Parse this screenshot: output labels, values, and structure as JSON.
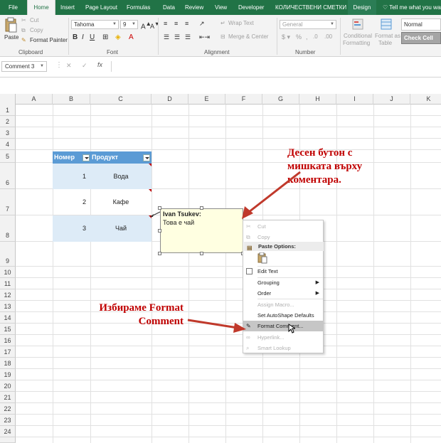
{
  "ribbon": {
    "tabs": [
      "File",
      "Home",
      "Insert",
      "Page Layout",
      "Formulas",
      "Data",
      "Review",
      "View",
      "Developer",
      "КОЛИЧЕСТВЕНИ СМЕТКИ",
      "Design"
    ],
    "tell_me": "Tell me what you wan",
    "clipboard": {
      "paste": "Paste",
      "cut": "Cut",
      "copy": "Copy",
      "format_painter": "Format Painter",
      "label": "Clipboard"
    },
    "font": {
      "name": "Tahoma",
      "size": "9",
      "label": "Font"
    },
    "alignment": {
      "wrap_text": "Wrap Text",
      "merge_center": "Merge & Center",
      "label": "Alignment"
    },
    "number": {
      "format": "General",
      "label": "Number"
    },
    "styles": {
      "conditional": "Conditional",
      "formatting": "Formatting",
      "format_as": "Format as",
      "table": "Table",
      "normal": "Normal",
      "check_cell": "Check Cell"
    }
  },
  "formula_bar": {
    "name_box": "Comment 3",
    "fx": "fx",
    "cancel": "✕",
    "enter": "✓",
    "value": ""
  },
  "grid": {
    "columns": [
      "A",
      "B",
      "C",
      "D",
      "E",
      "F",
      "G",
      "H",
      "I",
      "J",
      "K"
    ],
    "rows": [
      "1",
      "2",
      "3",
      "4",
      "5",
      "6",
      "7",
      "8",
      "9",
      "10",
      "11",
      "12",
      "13",
      "14",
      "15",
      "16",
      "17",
      "18",
      "19",
      "20",
      "21",
      "22",
      "23",
      "24"
    ]
  },
  "table": {
    "headers": [
      "Номер",
      "Продукт"
    ],
    "rows": [
      {
        "num": "1",
        "product": "Вода"
      },
      {
        "num": "2",
        "product": "Кафе"
      },
      {
        "num": "3",
        "product": "Чай"
      }
    ]
  },
  "comment": {
    "author": "Ivan Tsukev:",
    "text": "Това е чай"
  },
  "context_menu": {
    "cut": "Cut",
    "copy": "Copy",
    "paste_options": "Paste Options:",
    "edit_text": "Edit Text",
    "grouping": "Grouping",
    "order": "Order",
    "assign_macro": "Assign Macro...",
    "set_autoshape": "Set AutoShape Defaults",
    "format_comment": "Format Comment...",
    "hyperlink": "Hyperlink...",
    "smart_lookup": "Smart Lookup"
  },
  "annotations": {
    "top": [
      "Десен бутон с",
      "мишката върху",
      "коментара."
    ],
    "bottom": [
      "Избираме Format",
      "Comment"
    ]
  },
  "colors": {
    "excel_green": "#217346",
    "table_header": "#5b9bd5",
    "table_band": "#ddebf7",
    "annotation": "#c00000",
    "comment_bg": "#ffffe1"
  }
}
